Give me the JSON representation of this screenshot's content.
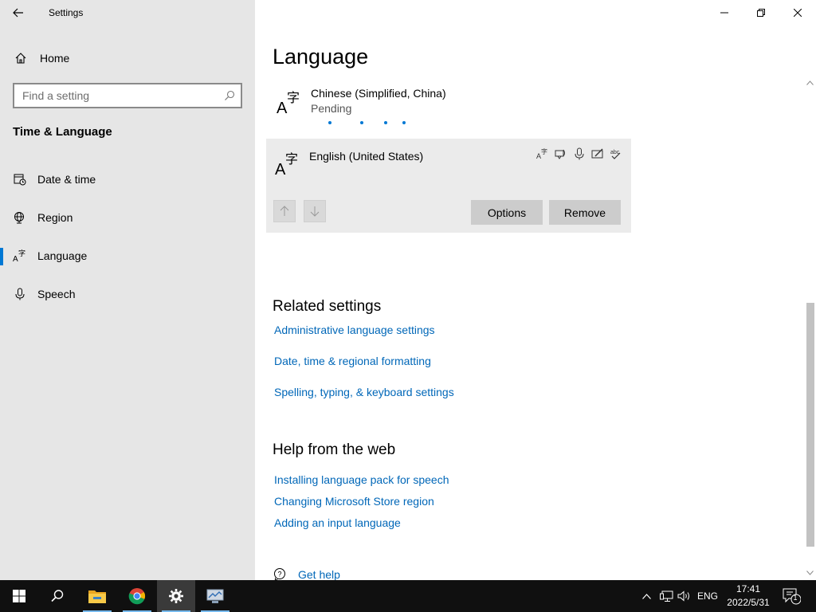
{
  "app": {
    "title": "Settings"
  },
  "sidebar": {
    "home_label": "Home",
    "search_placeholder": "Find a setting",
    "section_title": "Time & Language",
    "items": [
      {
        "label": "Date & time",
        "icon": "calendar-clock-icon"
      },
      {
        "label": "Region",
        "icon": "globe-icon"
      },
      {
        "label": "Language",
        "icon": "language-icon",
        "active": true
      },
      {
        "label": "Speech",
        "icon": "microphone-icon"
      }
    ]
  },
  "main": {
    "title": "Language",
    "languages": [
      {
        "name": "Chinese (Simplified, China)",
        "status": "Pending"
      },
      {
        "name": "English (United States)",
        "feature_icons": [
          "display-language-icon",
          "text-to-speech-icon",
          "speech-recognition-icon",
          "handwriting-icon",
          "spellcheck-icon"
        ]
      }
    ],
    "options_label": "Options",
    "remove_label": "Remove",
    "related": {
      "title": "Related settings",
      "links": [
        "Administrative language settings",
        "Date, time & regional formatting",
        "Spelling, typing, & keyboard settings"
      ]
    },
    "help": {
      "title": "Help from the web",
      "links": [
        "Installing language pack for speech",
        "Changing Microsoft Store region",
        "Adding an input language"
      ]
    },
    "get_help": "Get help"
  },
  "taskbar": {
    "apps": [
      "start-icon",
      "search-icon",
      "file-explorer-icon",
      "chrome-icon",
      "settings-icon",
      "network-app-icon"
    ],
    "language": "ENG",
    "time": "17:41",
    "date": "2022/5/31",
    "notifications": "1"
  },
  "colors": {
    "accent": "#0078d4",
    "link": "#0067b8",
    "sidebar_bg": "#e6e6e6",
    "taskbar_bg": "#101010"
  }
}
